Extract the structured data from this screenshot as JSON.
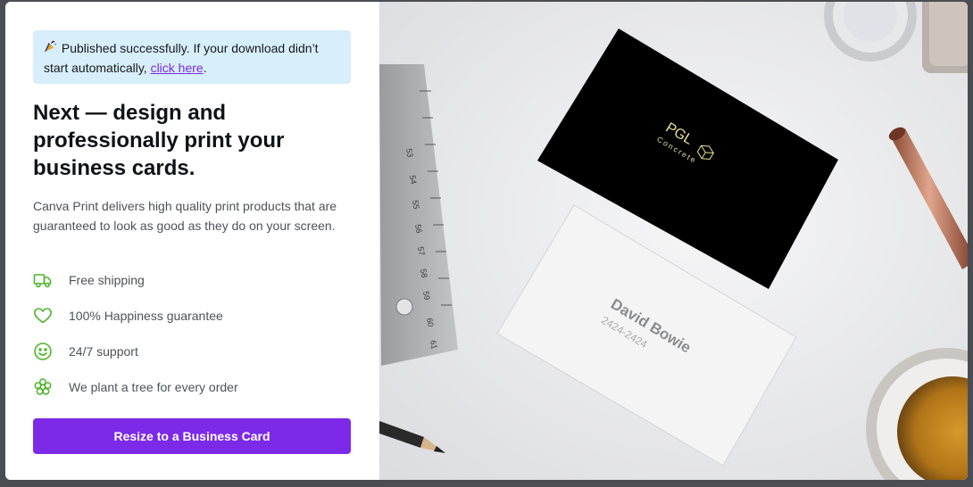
{
  "banner": {
    "icon": "party-popper-icon",
    "text_before": "Published successfully. If your download didn’t start automatically, ",
    "link": "click here",
    "text_after": "."
  },
  "headline": "Next — design and professionally print your business cards.",
  "description": "Canva Print delivers high quality print products that are guaranteed to look as good as they do on your screen.",
  "features": [
    {
      "icon": "truck-icon",
      "label": "Free shipping"
    },
    {
      "icon": "heart-icon",
      "label": "100% Happiness guarantee"
    },
    {
      "icon": "smiley-icon",
      "label": "24/7 support"
    },
    {
      "icon": "flower-icon",
      "label": "We plant a tree for every order"
    }
  ],
  "cta_label": "Resize to a Business Card",
  "preview": {
    "card_front_brand": "PGL",
    "card_front_sub": "Concrete",
    "card_back_name": "David Bowie",
    "card_back_phone": "2424-2424",
    "ruler_numbers": [
      "53",
      "54",
      "55",
      "56",
      "57",
      "58",
      "59",
      "60",
      "61"
    ]
  },
  "colors": {
    "accent": "#7d2ae8",
    "banner_bg": "#d7eefb",
    "feature_icon": "#4fb52b",
    "link": "#7a2be0"
  }
}
